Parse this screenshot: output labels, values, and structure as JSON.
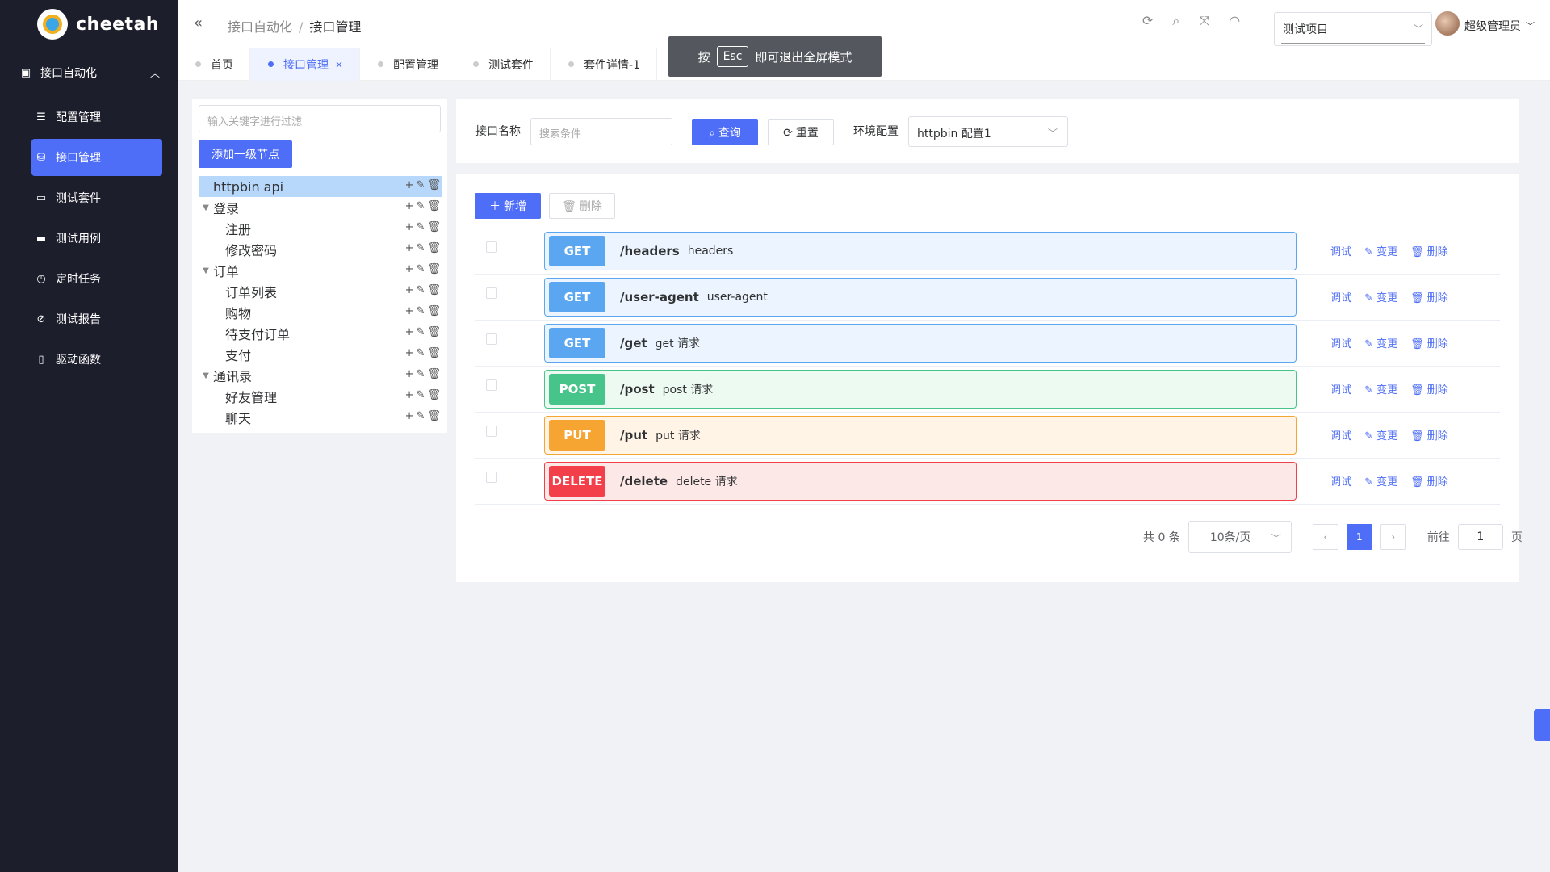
{
  "app": {
    "name": "cheetah"
  },
  "sidebar": {
    "group_label": "接口自动化",
    "items": [
      {
        "label": "配置管理",
        "icon": "list-icon"
      },
      {
        "label": "接口管理",
        "icon": "database-icon"
      },
      {
        "label": "测试套件",
        "icon": "briefcase-icon"
      },
      {
        "label": "测试用例",
        "icon": "suitcase-icon"
      },
      {
        "label": "定时任务",
        "icon": "stopwatch-icon"
      },
      {
        "label": "测试报告",
        "icon": "compass-icon"
      },
      {
        "label": "驱动函数",
        "icon": "book-icon"
      }
    ]
  },
  "header": {
    "breadcrumb": [
      "接口自动化",
      "接口管理"
    ],
    "project": "测试项目",
    "user": "超级管理员"
  },
  "tabs": [
    "首页",
    "接口管理",
    "配置管理",
    "测试套件",
    "套件详情-1"
  ],
  "toast": {
    "prefix": "按",
    "key": "Esc",
    "suffix": "即可退出全屏模式"
  },
  "tree": {
    "filter_placeholder": "输入关键字进行过滤",
    "add_root": "添加一级节点",
    "nodes": [
      {
        "label": "httpbin api",
        "level": 0
      },
      {
        "label": "登录",
        "level": 0
      },
      {
        "label": "注册",
        "level": 1
      },
      {
        "label": "修改密码",
        "level": 1
      },
      {
        "label": "订单",
        "level": 0
      },
      {
        "label": "订单列表",
        "level": 1
      },
      {
        "label": "购物",
        "level": 1
      },
      {
        "label": "待支付订单",
        "level": 1
      },
      {
        "label": "支付",
        "level": 1
      },
      {
        "label": "通讯录",
        "level": 0
      },
      {
        "label": "好友管理",
        "level": 1
      },
      {
        "label": "聊天",
        "level": 1
      }
    ]
  },
  "filter": {
    "name_label": "接口名称",
    "name_placeholder": "搜索条件",
    "query": "查询",
    "reset": "重置",
    "env_label": "环境配置",
    "env_value": "httpbin 配置1"
  },
  "toolbar": {
    "add": "新增",
    "delete": "删除"
  },
  "apis": [
    {
      "method": "GET",
      "path": "/headers",
      "desc": "headers",
      "color": "#5aa6f0",
      "bg": "#ecf5ff",
      "border": "#5aa6f0"
    },
    {
      "method": "GET",
      "path": "/user-agent",
      "desc": "user-agent",
      "color": "#5aa6f0",
      "bg": "#ecf5ff",
      "border": "#5aa6f0"
    },
    {
      "method": "GET",
      "path": "/get",
      "desc": "get 请求",
      "color": "#5aa6f0",
      "bg": "#ecf5ff",
      "border": "#5aa6f0"
    },
    {
      "method": "POST",
      "path": "/post",
      "desc": "post 请求",
      "color": "#47c48a",
      "bg": "#ecfaf1",
      "border": "#47c48a"
    },
    {
      "method": "PUT",
      "path": "/put",
      "desc": "put 请求",
      "color": "#f6a432",
      "bg": "#fff4e6",
      "border": "#f6a432"
    },
    {
      "method": "DELETE",
      "path": "/delete",
      "desc": "delete 请求",
      "color": "#f23f4a",
      "bg": "#fde8e8",
      "border": "#f23f4a"
    }
  ],
  "row_actions": {
    "debug": "调试",
    "edit": "变更",
    "delete": "删除"
  },
  "pagination": {
    "total": "共 0 条",
    "size": "10条/页",
    "page": "1",
    "goto_label": "前往",
    "goto_value": "1",
    "page_suffix": "页"
  }
}
